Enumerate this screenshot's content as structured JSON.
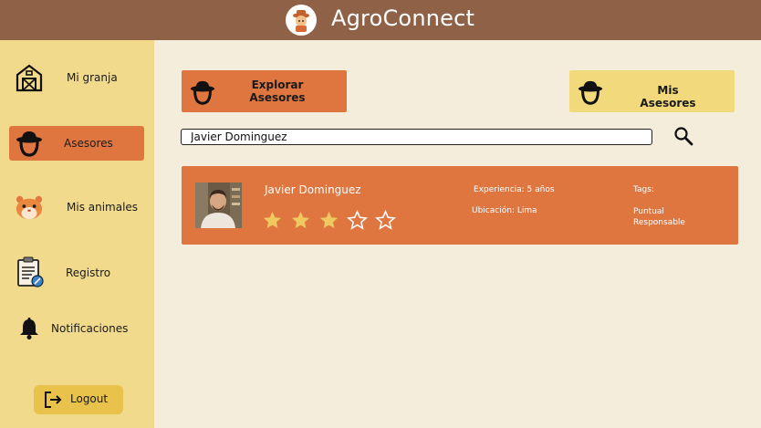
{
  "header": {
    "title": "AgroConnect"
  },
  "sidebar": {
    "items": [
      {
        "label": "Mi granja",
        "icon": "barn-icon",
        "active": false
      },
      {
        "label": "Asesores",
        "icon": "farmer-icon",
        "active": true
      },
      {
        "label": "Mis animales",
        "icon": "hamster-icon",
        "active": false
      },
      {
        "label": "Registro",
        "icon": "clipboard-icon",
        "active": false
      },
      {
        "label": "Notificaciones",
        "icon": "bell-icon",
        "active": false
      }
    ],
    "logout_label": "Logout"
  },
  "main": {
    "explore_label": "Explorar Asesores",
    "mine_label": "Mis Asesores",
    "search": {
      "value": "Javier Dominguez"
    },
    "results": [
      {
        "name": "Javier Dominguez",
        "rating": 3,
        "rating_max": 5,
        "experience": "Experiencia: 5 años",
        "location": "Ubicación: Lima",
        "tags_label": "Tags:",
        "tags": [
          "Puntual",
          "Responsable"
        ]
      }
    ]
  },
  "colors": {
    "header": "#8f6248",
    "sidebar": "#f2da8c",
    "accent": "#df7640",
    "secondary": "#f2da7c",
    "background": "#f5eddc",
    "star": "#f0c860"
  }
}
